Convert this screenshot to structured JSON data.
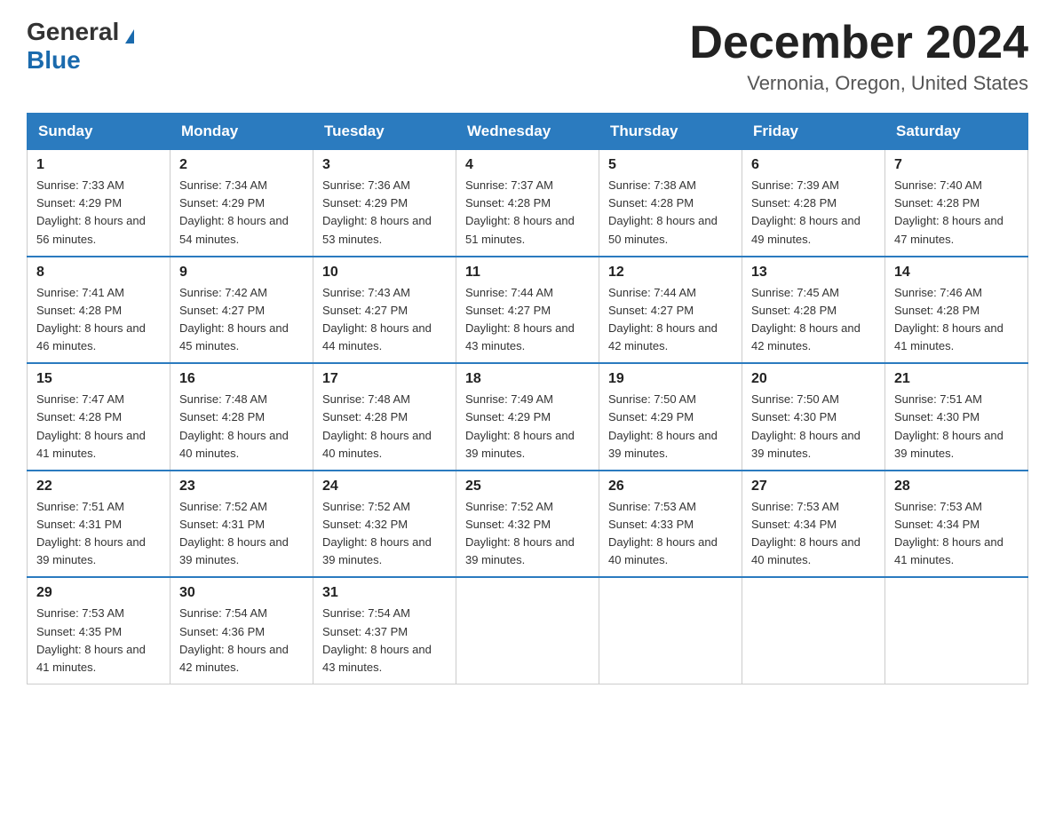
{
  "header": {
    "logo_general": "General",
    "logo_blue": "Blue",
    "title": "December 2024",
    "location": "Vernonia, Oregon, United States"
  },
  "days_of_week": [
    "Sunday",
    "Monday",
    "Tuesday",
    "Wednesday",
    "Thursday",
    "Friday",
    "Saturday"
  ],
  "weeks": [
    [
      {
        "day": 1,
        "sunrise": "7:33 AM",
        "sunset": "4:29 PM",
        "daylight": "8 hours and 56 minutes."
      },
      {
        "day": 2,
        "sunrise": "7:34 AM",
        "sunset": "4:29 PM",
        "daylight": "8 hours and 54 minutes."
      },
      {
        "day": 3,
        "sunrise": "7:36 AM",
        "sunset": "4:29 PM",
        "daylight": "8 hours and 53 minutes."
      },
      {
        "day": 4,
        "sunrise": "7:37 AM",
        "sunset": "4:28 PM",
        "daylight": "8 hours and 51 minutes."
      },
      {
        "day": 5,
        "sunrise": "7:38 AM",
        "sunset": "4:28 PM",
        "daylight": "8 hours and 50 minutes."
      },
      {
        "day": 6,
        "sunrise": "7:39 AM",
        "sunset": "4:28 PM",
        "daylight": "8 hours and 49 minutes."
      },
      {
        "day": 7,
        "sunrise": "7:40 AM",
        "sunset": "4:28 PM",
        "daylight": "8 hours and 47 minutes."
      }
    ],
    [
      {
        "day": 8,
        "sunrise": "7:41 AM",
        "sunset": "4:28 PM",
        "daylight": "8 hours and 46 minutes."
      },
      {
        "day": 9,
        "sunrise": "7:42 AM",
        "sunset": "4:27 PM",
        "daylight": "8 hours and 45 minutes."
      },
      {
        "day": 10,
        "sunrise": "7:43 AM",
        "sunset": "4:27 PM",
        "daylight": "8 hours and 44 minutes."
      },
      {
        "day": 11,
        "sunrise": "7:44 AM",
        "sunset": "4:27 PM",
        "daylight": "8 hours and 43 minutes."
      },
      {
        "day": 12,
        "sunrise": "7:44 AM",
        "sunset": "4:27 PM",
        "daylight": "8 hours and 42 minutes."
      },
      {
        "day": 13,
        "sunrise": "7:45 AM",
        "sunset": "4:28 PM",
        "daylight": "8 hours and 42 minutes."
      },
      {
        "day": 14,
        "sunrise": "7:46 AM",
        "sunset": "4:28 PM",
        "daylight": "8 hours and 41 minutes."
      }
    ],
    [
      {
        "day": 15,
        "sunrise": "7:47 AM",
        "sunset": "4:28 PM",
        "daylight": "8 hours and 41 minutes."
      },
      {
        "day": 16,
        "sunrise": "7:48 AM",
        "sunset": "4:28 PM",
        "daylight": "8 hours and 40 minutes."
      },
      {
        "day": 17,
        "sunrise": "7:48 AM",
        "sunset": "4:28 PM",
        "daylight": "8 hours and 40 minutes."
      },
      {
        "day": 18,
        "sunrise": "7:49 AM",
        "sunset": "4:29 PM",
        "daylight": "8 hours and 39 minutes."
      },
      {
        "day": 19,
        "sunrise": "7:50 AM",
        "sunset": "4:29 PM",
        "daylight": "8 hours and 39 minutes."
      },
      {
        "day": 20,
        "sunrise": "7:50 AM",
        "sunset": "4:30 PM",
        "daylight": "8 hours and 39 minutes."
      },
      {
        "day": 21,
        "sunrise": "7:51 AM",
        "sunset": "4:30 PM",
        "daylight": "8 hours and 39 minutes."
      }
    ],
    [
      {
        "day": 22,
        "sunrise": "7:51 AM",
        "sunset": "4:31 PM",
        "daylight": "8 hours and 39 minutes."
      },
      {
        "day": 23,
        "sunrise": "7:52 AM",
        "sunset": "4:31 PM",
        "daylight": "8 hours and 39 minutes."
      },
      {
        "day": 24,
        "sunrise": "7:52 AM",
        "sunset": "4:32 PM",
        "daylight": "8 hours and 39 minutes."
      },
      {
        "day": 25,
        "sunrise": "7:52 AM",
        "sunset": "4:32 PM",
        "daylight": "8 hours and 39 minutes."
      },
      {
        "day": 26,
        "sunrise": "7:53 AM",
        "sunset": "4:33 PM",
        "daylight": "8 hours and 40 minutes."
      },
      {
        "day": 27,
        "sunrise": "7:53 AM",
        "sunset": "4:34 PM",
        "daylight": "8 hours and 40 minutes."
      },
      {
        "day": 28,
        "sunrise": "7:53 AM",
        "sunset": "4:34 PM",
        "daylight": "8 hours and 41 minutes."
      }
    ],
    [
      {
        "day": 29,
        "sunrise": "7:53 AM",
        "sunset": "4:35 PM",
        "daylight": "8 hours and 41 minutes."
      },
      {
        "day": 30,
        "sunrise": "7:54 AM",
        "sunset": "4:36 PM",
        "daylight": "8 hours and 42 minutes."
      },
      {
        "day": 31,
        "sunrise": "7:54 AM",
        "sunset": "4:37 PM",
        "daylight": "8 hours and 43 minutes."
      },
      null,
      null,
      null,
      null
    ]
  ]
}
